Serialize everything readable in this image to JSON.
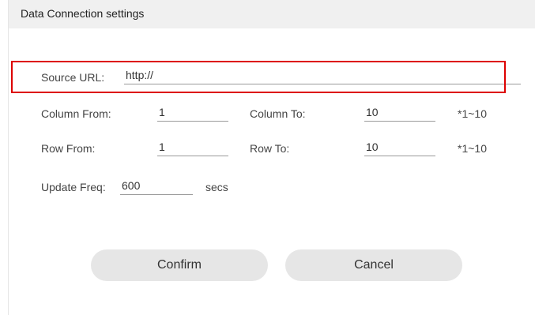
{
  "dialog": {
    "title": "Data Connection settings"
  },
  "source": {
    "label": "Source URL:",
    "value": "http://"
  },
  "column": {
    "from_label": "Column From:",
    "from_value": "1",
    "to_label": "Column To:",
    "to_value": "10",
    "hint": "*1~10"
  },
  "row": {
    "from_label": "Row From:",
    "from_value": "1",
    "to_label": "Row To:",
    "to_value": "10",
    "hint": "*1~10"
  },
  "update": {
    "label": "Update Freq:",
    "value": "600",
    "unit": "secs"
  },
  "buttons": {
    "confirm": "Confirm",
    "cancel": "Cancel"
  },
  "colors": {
    "highlight": "#dd0000",
    "titlebar": "#f0f0f0",
    "button": "#e6e6e6"
  }
}
